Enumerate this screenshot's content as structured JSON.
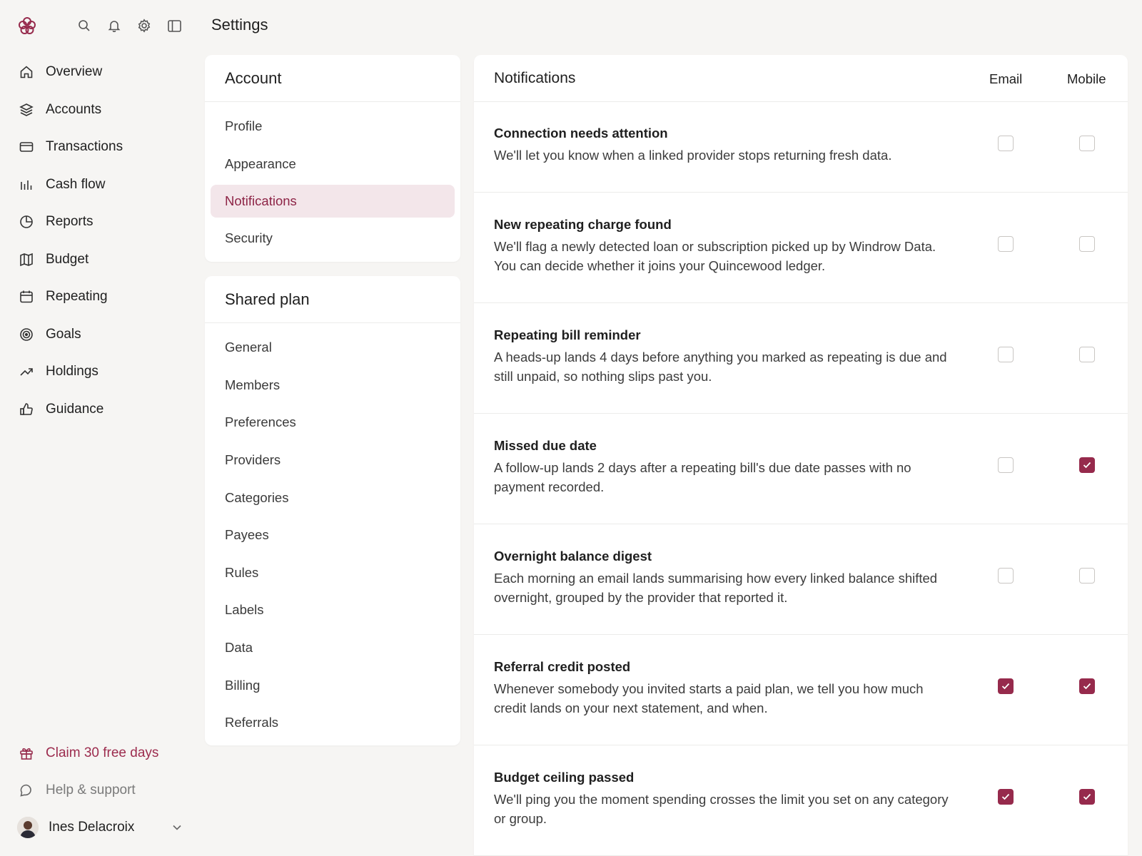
{
  "page_title": "Settings",
  "colors": {
    "accent": "#962a4c",
    "accent_soft": "#f3e6ea",
    "background": "#f6f5f3"
  },
  "topbar": {
    "icons": [
      "search-icon",
      "bell-icon",
      "gear-icon",
      "sidebar-toggle-icon"
    ]
  },
  "nav": {
    "items": [
      {
        "label": "Overview",
        "icon": "home-icon"
      },
      {
        "label": "Accounts",
        "icon": "layers-icon"
      },
      {
        "label": "Transactions",
        "icon": "card-icon"
      },
      {
        "label": "Cash flow",
        "icon": "bar-chart-icon"
      },
      {
        "label": "Reports",
        "icon": "pie-chart-icon"
      },
      {
        "label": "Budget",
        "icon": "map-icon"
      },
      {
        "label": "Repeating",
        "icon": "calendar-icon"
      },
      {
        "label": "Goals",
        "icon": "target-icon"
      },
      {
        "label": "Holdings",
        "icon": "trend-up-icon"
      },
      {
        "label": "Guidance",
        "icon": "thumbs-up-icon"
      }
    ]
  },
  "bottom": {
    "claim_label": "Claim 30 free days",
    "help_label": "Help & support",
    "user_name": "Ines Delacroix"
  },
  "account_card": {
    "title": "Account",
    "items": [
      "Profile",
      "Appearance",
      "Notifications",
      "Security"
    ],
    "active": "Notifications"
  },
  "shared_card": {
    "title": "Shared plan",
    "items": [
      "General",
      "Members",
      "Preferences",
      "Providers",
      "Categories",
      "Payees",
      "Rules",
      "Labels",
      "Data",
      "Billing",
      "Referrals"
    ]
  },
  "notifications": {
    "title": "Notifications",
    "col_email": "Email",
    "col_mobile": "Mobile",
    "rows": [
      {
        "title": "Connection needs attention",
        "desc": "We'll let you know when a linked provider stops returning fresh data.",
        "email": false,
        "mobile": false
      },
      {
        "title": "New repeating charge found",
        "desc": "We'll flag a newly detected loan or subscription picked up by Windrow Data. You can decide whether it joins your Quincewood ledger.",
        "email": false,
        "mobile": false
      },
      {
        "title": "Repeating bill reminder",
        "desc": "A heads-up lands 4 days before anything you marked as repeating is due and still unpaid, so nothing slips past you.",
        "email": false,
        "mobile": false
      },
      {
        "title": "Missed due date",
        "desc": "A follow-up lands 2 days after a repeating bill's due date passes with no payment recorded.",
        "email": false,
        "mobile": true
      },
      {
        "title": "Overnight balance digest",
        "desc": "Each morning an email lands summarising how every linked balance shifted overnight, grouped by the provider that reported it.",
        "email": false,
        "mobile": false
      },
      {
        "title": "Referral credit posted",
        "desc": "Whenever somebody you invited starts a paid plan, we tell you how much credit lands on your next statement, and when.",
        "email": true,
        "mobile": true
      },
      {
        "title": "Budget ceiling passed",
        "desc": "We'll ping you the moment spending crosses the limit you set on any category or group.",
        "email": true,
        "mobile": true
      }
    ]
  }
}
